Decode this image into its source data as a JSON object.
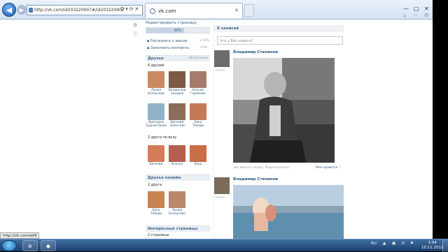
{
  "browser": {
    "address": "http://vk.com/id203220907#/id203220907",
    "tab_title": "vk.com",
    "status_url": "http://vk.com/edit"
  },
  "profile": {
    "edit_link": "Редактировать страницу",
    "progress": "60%",
    "progress_value": 0.6,
    "tasks": [
      {
        "label": "Рассказать о школе",
        "pct": "+15%"
      },
      {
        "label": "Заполнить контакты",
        "pct": "+5%"
      }
    ]
  },
  "friends": {
    "title": "Друзья",
    "updates": "обновления",
    "count": "6 друзей",
    "list": [
      {
        "name": "Лилия Белоусова",
        "color": "#c98a5e"
      },
      {
        "name": "Владислав Захаров",
        "color": "#7d5a45"
      },
      {
        "name": "Ксения Горамова",
        "color": "#a57c6a"
      },
      {
        "name": "Виктория Бурнастрова",
        "color": "#8fb2c9"
      },
      {
        "name": "Евгений Запкечий",
        "color": "#8b6e59"
      },
      {
        "name": "Бека Тебоди",
        "color": "#c47a58"
      }
    ],
    "university_count": "2 друга по вузу",
    "university_list": [
      {
        "name": "Евгений",
        "color": "#d47d5a"
      },
      {
        "name": "Ксенья",
        "color": "#b45f4f"
      },
      {
        "name": "Бека",
        "color": "#c86e49"
      }
    ]
  },
  "online": {
    "title": "Друзья онлайн",
    "count": "2 друга",
    "list": [
      {
        "name": "Бека Тебоди",
        "color": "#c7844f"
      },
      {
        "name": "Лилия Белоусова",
        "color": "#b9876a"
      }
    ]
  },
  "interests": {
    "title": "Интересные страницы",
    "count": "2 страницы"
  },
  "wall": {
    "header": "8 записей",
    "placeholder": "Что у Вас нового?",
    "posts": [
      {
        "author": "Владимир Степанов",
        "online": "Online",
        "meta": "две минуты назад  |  Редактировать",
        "like": "Мне нравится ♡"
      },
      {
        "author": "Владимир Степанов",
        "online": "Online"
      }
    ]
  },
  "taskbar": {
    "lang": "RU",
    "time": "1:04",
    "date": "10.11.2012"
  }
}
